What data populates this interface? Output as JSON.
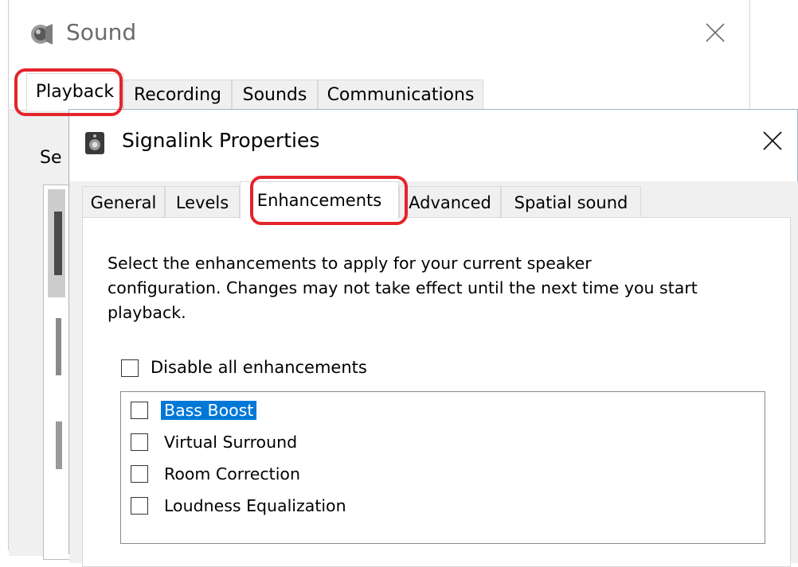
{
  "sound_window": {
    "title": "Sound",
    "tabs": [
      {
        "label": "Playback",
        "active": true
      },
      {
        "label": "Recording",
        "active": false
      },
      {
        "label": "Sounds",
        "active": false
      },
      {
        "label": "Communications",
        "active": false
      }
    ],
    "partial_label": "Se"
  },
  "properties_dialog": {
    "title": "Signalink Properties",
    "tabs": [
      {
        "label": "General",
        "active": false
      },
      {
        "label": "Levels",
        "active": false
      },
      {
        "label": "Enhancements",
        "active": true
      },
      {
        "label": "Advanced",
        "active": false
      },
      {
        "label": "Spatial sound",
        "active": false
      }
    ],
    "description_lines": [
      "Select the enhancements to apply for your current speaker",
      "configuration. Changes may not take effect until the next time you start",
      "playback."
    ],
    "disable_all": {
      "label": "Disable all enhancements",
      "checked": false
    },
    "enhancements": [
      {
        "label": "Bass Boost",
        "checked": false,
        "selected": true
      },
      {
        "label": "Virtual Surround",
        "checked": false,
        "selected": false
      },
      {
        "label": "Room Correction",
        "checked": false,
        "selected": false
      },
      {
        "label": "Loudness Equalization",
        "checked": false,
        "selected": false
      }
    ]
  },
  "colors": {
    "highlight": "#e3242b",
    "selection": "#0078d7",
    "dialog_bg": "#f0f0f0"
  },
  "icons": {
    "sound_window": "speaker-icon",
    "properties_dialog": "device-speaker-icon",
    "close": "close-icon"
  }
}
